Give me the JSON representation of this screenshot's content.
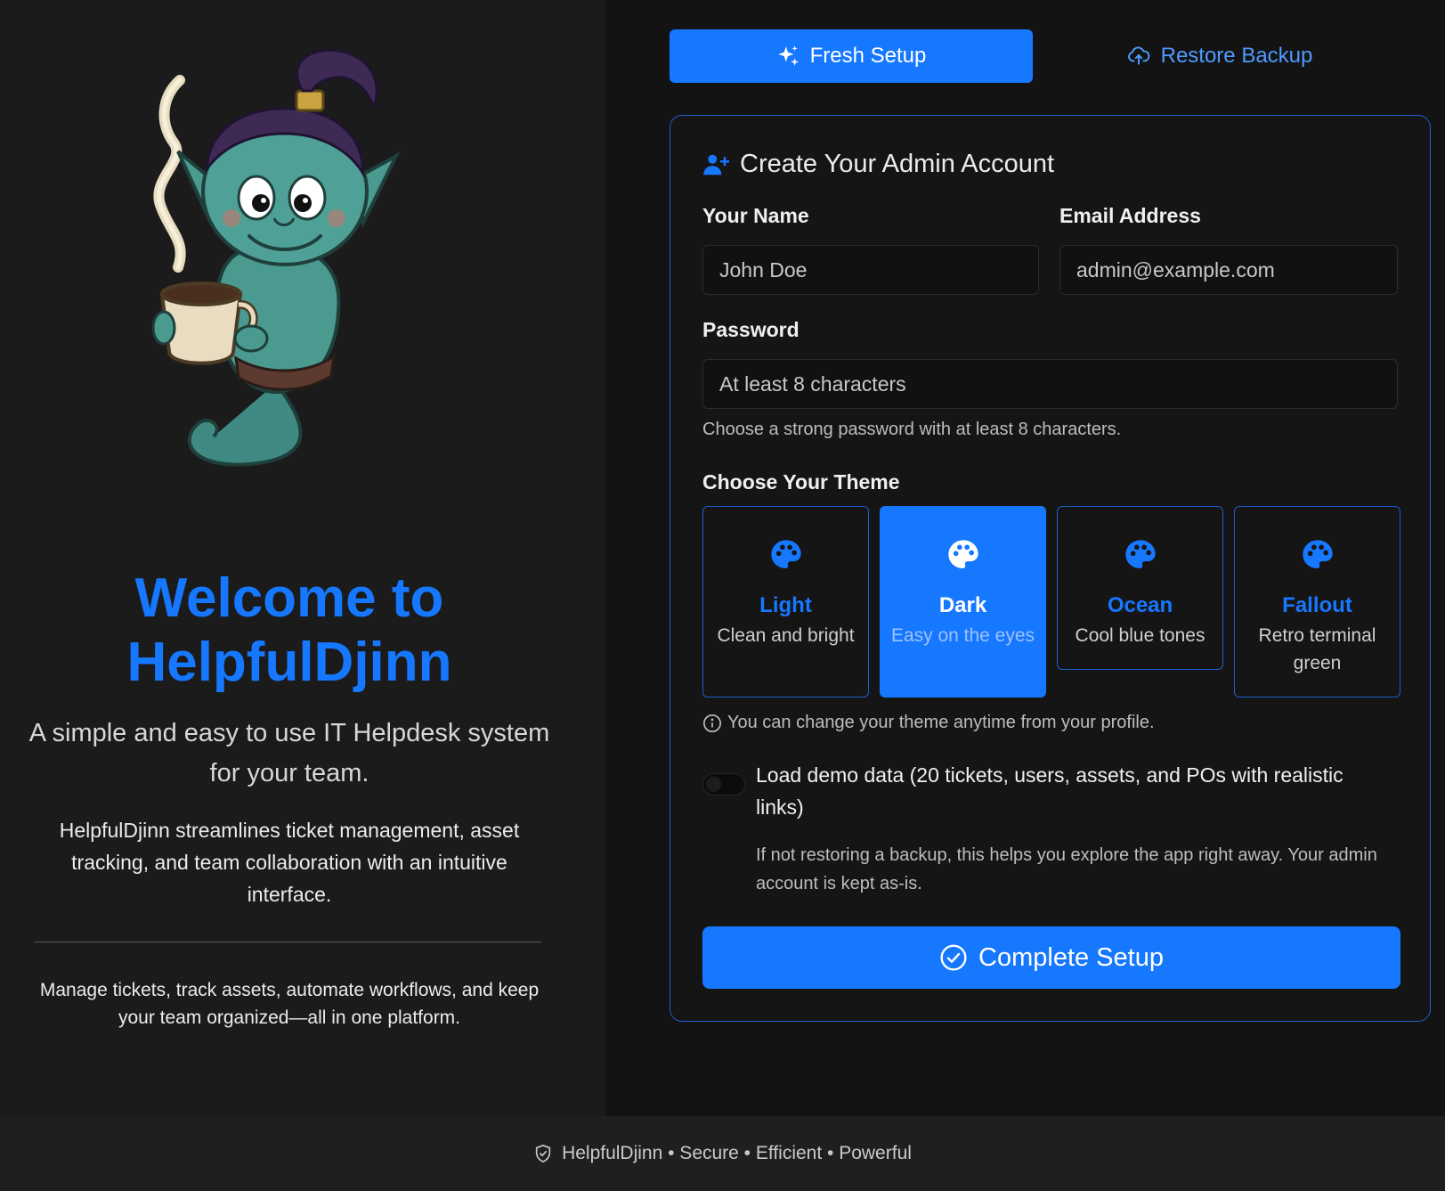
{
  "welcome": {
    "title_line1": "Welcome to",
    "title_line2": "HelpfulDjinn",
    "tagline": "A simple and easy to use IT Helpdesk system for your team.",
    "description": "HelpfulDjinn streamlines ticket management, asset tracking, and team collaboration with an intuitive interface.",
    "subdescription": "Manage tickets, track assets, automate workflows, and keep your team organized—all in one platform."
  },
  "tabs": {
    "fresh_label": "Fresh Setup",
    "fresh_icon": "sparkles-icon",
    "restore_label": "Restore Backup",
    "restore_icon": "cloud-upload-icon"
  },
  "form": {
    "title": "Create Your Admin Account",
    "title_icon": "user-plus-icon",
    "name_label": "Your Name",
    "name_placeholder": "John Doe",
    "email_label": "Email Address",
    "email_placeholder": "admin@example.com",
    "password_label": "Password",
    "password_placeholder": "At least 8 characters",
    "password_hint": "Choose a strong password with at least 8 characters.",
    "theme_label": "Choose Your Theme",
    "themes": [
      {
        "name": "Light",
        "desc": "Clean and bright",
        "selected": false,
        "icon": "palette-icon"
      },
      {
        "name": "Dark",
        "desc": "Easy on the eyes",
        "selected": true,
        "icon": "palette-icon"
      },
      {
        "name": "Ocean",
        "desc": "Cool blue tones",
        "selected": false,
        "icon": "palette-icon"
      },
      {
        "name": "Fallout",
        "desc": "Retro terminal green",
        "selected": false,
        "icon": "palette-icon"
      }
    ],
    "theme_hint": "You can change your theme anytime from your profile.",
    "demo_label": "Load demo data (20 tickets, users, assets, and POs with realistic links)",
    "demo_help": "If not restoring a backup, this helps you explore the app right away. Your admin account is kept as-is.",
    "demo_enabled": false,
    "submit_label": "Complete Setup",
    "submit_icon": "check-circle-icon"
  },
  "footer": {
    "icon": "shield-icon",
    "text": "HelpfulDjinn • Secure • Efficient • Powerful"
  },
  "colors": {
    "accent": "#1677ff",
    "background": "#131313",
    "panel": "#1b1b1b"
  }
}
